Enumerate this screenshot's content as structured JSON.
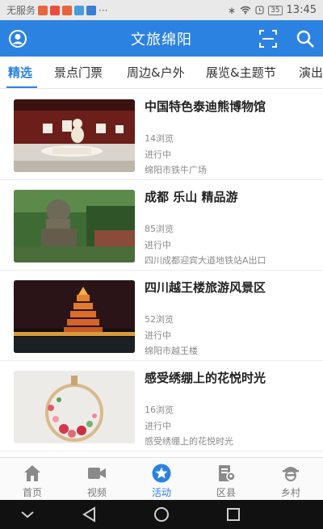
{
  "status_bar": {
    "carrier": "无服务",
    "battery": "35",
    "time": "13:45",
    "more": "···"
  },
  "header": {
    "title": "文旅绵阳",
    "icons": [
      "user-circle-icon",
      "scan-icon",
      "search-icon"
    ],
    "color": "#2b82e0"
  },
  "tabs": [
    {
      "label": "精选",
      "active": true
    },
    {
      "label": "景点门票"
    },
    {
      "label": "周边&户外"
    },
    {
      "label": "展览&主题节"
    },
    {
      "label": "演出"
    }
  ],
  "items": [
    {
      "title": "中国特色泰迪熊博物馆",
      "views": "14浏览",
      "status": "进行中",
      "location": "绵阳市铁牛广场",
      "image": "teddy-bear-museum-hall"
    },
    {
      "title": "成都 乐山 精品游",
      "views": "85浏览",
      "status": "进行中",
      "location": "四川成都迎宾大道地铁站A出口",
      "image": "leshan-giant-buddha"
    },
    {
      "title": "四川越王楼旅游风景区",
      "views": "52浏览",
      "status": "进行中",
      "location": "绵阳市越王楼",
      "image": "yuewang-tower-night"
    },
    {
      "title": "感受绣绷上的花悦时光",
      "views": "16浏览",
      "status": "进行中",
      "location": "感受绣绷上的花悦时光",
      "image": "embroidery-hoop-flowers"
    }
  ],
  "bottom_nav": [
    {
      "label": "首页",
      "icon": "home-icon"
    },
    {
      "label": "视频",
      "icon": "video-icon"
    },
    {
      "label": "活动",
      "icon": "star-badge-icon",
      "active": true
    },
    {
      "label": "区县",
      "icon": "map-pin-icon"
    },
    {
      "label": "乡村",
      "icon": "village-icon"
    }
  ],
  "system_nav": [
    "back-chevron-icon",
    "back-triangle-icon",
    "home-circle-icon",
    "recents-square-icon"
  ]
}
